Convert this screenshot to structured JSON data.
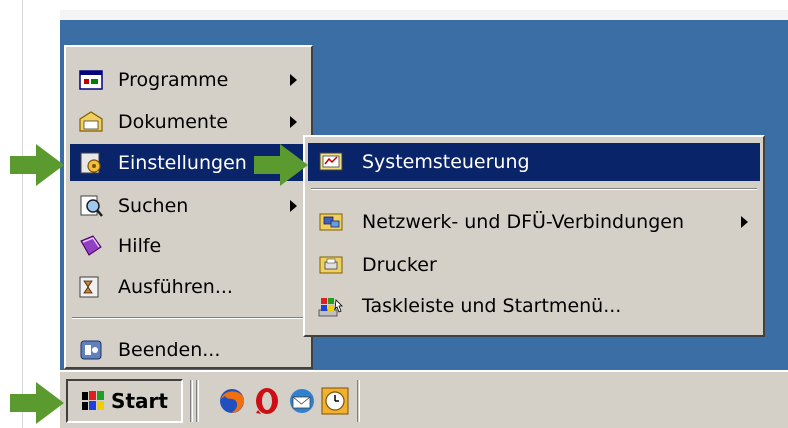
{
  "start_menu": {
    "items": [
      {
        "label": "Programme",
        "icon": "programs-icon",
        "has_submenu": true
      },
      {
        "label": "Dokumente",
        "icon": "documents-icon",
        "has_submenu": true
      },
      {
        "label": "Einstellungen",
        "icon": "settings-icon",
        "has_submenu": true,
        "selected": true
      },
      {
        "label": "Suchen",
        "icon": "search-icon",
        "has_submenu": true
      },
      {
        "label": "Hilfe",
        "icon": "help-icon",
        "has_submenu": false
      },
      {
        "label": "Ausführen...",
        "icon": "run-icon",
        "has_submenu": false
      },
      {
        "label": "Beenden...",
        "icon": "shutdown-icon",
        "has_submenu": false
      }
    ]
  },
  "settings_submenu": {
    "items": [
      {
        "label": "Systemsteuerung",
        "icon": "control-panel-icon",
        "selected": true
      },
      {
        "label": "Netzwerk- und DFÜ-Verbindungen",
        "icon": "network-connections-icon",
        "has_submenu": true
      },
      {
        "label": "Drucker",
        "icon": "printers-icon"
      },
      {
        "label": "Taskleiste und Startmenü...",
        "icon": "taskbar-startmenu-icon"
      }
    ]
  },
  "taskbar": {
    "start_label": "Start",
    "quick_launch": [
      "firefox-icon",
      "opera-icon",
      "thunderbird-icon",
      "clock-icon"
    ]
  },
  "colors": {
    "selection": "#0a246a",
    "menu_face": "#d4d0c8",
    "desktop": "#3a6ea5",
    "arrow": "#5b9a2e"
  }
}
